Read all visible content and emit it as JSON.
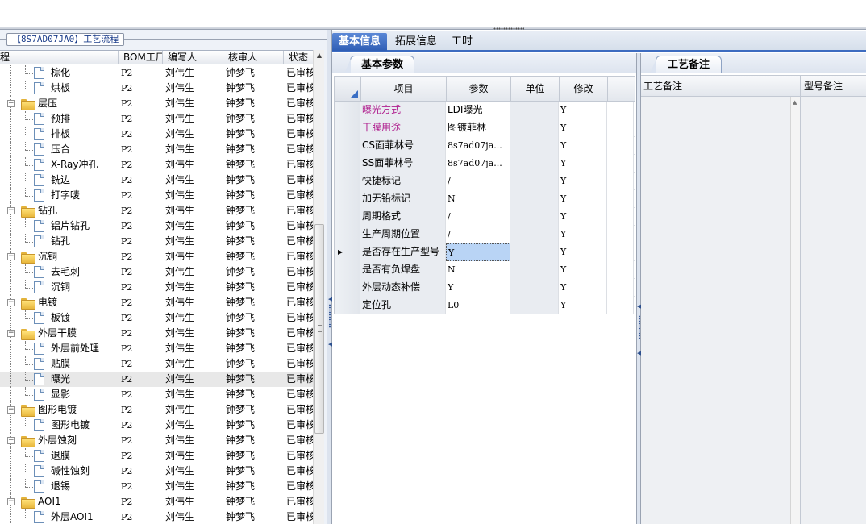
{
  "left_panel": {
    "title": "【8S7AD07JA0】工艺流程",
    "columns": [
      "程",
      "BOM工厂",
      "编写人",
      "核审人",
      "状态"
    ],
    "rows": [
      {
        "name": "棕化",
        "type": "doc",
        "bom": "P2",
        "author": "刘伟生",
        "reviewer": "钟梦飞",
        "status": "已审核"
      },
      {
        "name": "烘板",
        "type": "doc",
        "bom": "P2",
        "author": "刘伟生",
        "reviewer": "钟梦飞",
        "status": "已审核"
      },
      {
        "name": "层压",
        "type": "folder",
        "bom": "P2",
        "author": "刘伟生",
        "reviewer": "钟梦飞",
        "status": "已审核"
      },
      {
        "name": "预排",
        "type": "doc",
        "bom": "P2",
        "author": "刘伟生",
        "reviewer": "钟梦飞",
        "status": "已审核"
      },
      {
        "name": "排板",
        "type": "doc",
        "bom": "P2",
        "author": "刘伟生",
        "reviewer": "钟梦飞",
        "status": "已审核"
      },
      {
        "name": "压合",
        "type": "doc",
        "bom": "P2",
        "author": "刘伟生",
        "reviewer": "钟梦飞",
        "status": "已审核"
      },
      {
        "name": "X-Ray冲孔",
        "type": "doc",
        "bom": "P2",
        "author": "刘伟生",
        "reviewer": "钟梦飞",
        "status": "已审核"
      },
      {
        "name": "铣边",
        "type": "doc",
        "bom": "P2",
        "author": "刘伟生",
        "reviewer": "钟梦飞",
        "status": "已审核"
      },
      {
        "name": "打字唛",
        "type": "doc",
        "bom": "P2",
        "author": "刘伟生",
        "reviewer": "钟梦飞",
        "status": "已审核"
      },
      {
        "name": "钻孔",
        "type": "folder",
        "bom": "P2",
        "author": "刘伟生",
        "reviewer": "钟梦飞",
        "status": "已审核"
      },
      {
        "name": "铝片钻孔",
        "type": "doc",
        "bom": "P2",
        "author": "刘伟生",
        "reviewer": "钟梦飞",
        "status": "已审核"
      },
      {
        "name": "钻孔",
        "type": "doc",
        "bom": "P2",
        "author": "刘伟生",
        "reviewer": "钟梦飞",
        "status": "已审核"
      },
      {
        "name": "沉铜",
        "type": "folder",
        "bom": "P2",
        "author": "刘伟生",
        "reviewer": "钟梦飞",
        "status": "已审核"
      },
      {
        "name": "去毛刺",
        "type": "doc",
        "bom": "P2",
        "author": "刘伟生",
        "reviewer": "钟梦飞",
        "status": "已审核"
      },
      {
        "name": "沉铜",
        "type": "doc",
        "bom": "P2",
        "author": "刘伟生",
        "reviewer": "钟梦飞",
        "status": "已审核"
      },
      {
        "name": "电镀",
        "type": "folder",
        "bom": "P2",
        "author": "刘伟生",
        "reviewer": "钟梦飞",
        "status": "已审核"
      },
      {
        "name": "板镀",
        "type": "doc",
        "bom": "P2",
        "author": "刘伟生",
        "reviewer": "钟梦飞",
        "status": "已审核"
      },
      {
        "name": "外层干膜",
        "type": "folder",
        "bom": "P2",
        "author": "刘伟生",
        "reviewer": "钟梦飞",
        "status": "已审核"
      },
      {
        "name": "外层前处理",
        "type": "doc",
        "bom": "P2",
        "author": "刘伟生",
        "reviewer": "钟梦飞",
        "status": "已审核"
      },
      {
        "name": "贴膜",
        "type": "doc",
        "bom": "P2",
        "author": "刘伟生",
        "reviewer": "钟梦飞",
        "status": "已审核"
      },
      {
        "name": "曝光",
        "type": "doc",
        "bom": "P2",
        "author": "刘伟生",
        "reviewer": "钟梦飞",
        "status": "已审核",
        "selected": true
      },
      {
        "name": "显影",
        "type": "doc",
        "bom": "P2",
        "author": "刘伟生",
        "reviewer": "钟梦飞",
        "status": "已审核"
      },
      {
        "name": "图形电镀",
        "type": "folder",
        "bom": "P2",
        "author": "刘伟生",
        "reviewer": "钟梦飞",
        "status": "已审核"
      },
      {
        "name": "图形电镀",
        "type": "doc",
        "bom": "P2",
        "author": "刘伟生",
        "reviewer": "钟梦飞",
        "status": "已审核"
      },
      {
        "name": "外层蚀刻",
        "type": "folder",
        "bom": "P2",
        "author": "刘伟生",
        "reviewer": "钟梦飞",
        "status": "已审核"
      },
      {
        "name": "退膜",
        "type": "doc",
        "bom": "P2",
        "author": "刘伟生",
        "reviewer": "钟梦飞",
        "status": "已审核"
      },
      {
        "name": "碱性蚀刻",
        "type": "doc",
        "bom": "P2",
        "author": "刘伟生",
        "reviewer": "钟梦飞",
        "status": "已审核"
      },
      {
        "name": "退锡",
        "type": "doc",
        "bom": "P2",
        "author": "刘伟生",
        "reviewer": "钟梦飞",
        "status": "已审核"
      },
      {
        "name": "AOI1",
        "type": "folder",
        "bom": "P2",
        "author": "刘伟生",
        "reviewer": "钟梦飞",
        "status": "已审核"
      },
      {
        "name": "外层AOI1",
        "type": "doc",
        "bom": "P2",
        "author": "刘伟生",
        "reviewer": "钟梦飞",
        "status": "已审核"
      }
    ]
  },
  "main_tabs": [
    "基本信息",
    "拓展信息",
    "工时"
  ],
  "basic_panel": {
    "tab": "基本参数",
    "columns": [
      "项目",
      "参数",
      "单位",
      "修改"
    ],
    "rows": [
      {
        "item": "曝光方式",
        "value": "LDI曝光",
        "unit": "",
        "mod": "Y",
        "highlight": true
      },
      {
        "item": "干膜用途",
        "value": "图镀菲林",
        "unit": "",
        "mod": "Y",
        "highlight": true
      },
      {
        "item": "CS面菲林号",
        "value": "8s7ad07ja...",
        "unit": "",
        "mod": "Y"
      },
      {
        "item": "SS面菲林号",
        "value": "8s7ad07ja...",
        "unit": "",
        "mod": "Y"
      },
      {
        "item": "快捷标记",
        "value": "/",
        "unit": "",
        "mod": "Y"
      },
      {
        "item": "加无铅标记",
        "value": "N",
        "unit": "",
        "mod": "Y"
      },
      {
        "item": "周期格式",
        "value": "/",
        "unit": "",
        "mod": "Y"
      },
      {
        "item": "生产周期位置",
        "value": "/",
        "unit": "",
        "mod": "Y"
      },
      {
        "item": "是否存在生产型号",
        "value": "Y",
        "unit": "",
        "mod": "Y",
        "current": true
      },
      {
        "item": "是否有负焊盘",
        "value": "N",
        "unit": "",
        "mod": "Y"
      },
      {
        "item": "外层动态补偿",
        "value": "Y",
        "unit": "",
        "mod": "Y"
      },
      {
        "item": "定位孔",
        "value": "L0",
        "unit": "",
        "mod": "Y"
      }
    ]
  },
  "notes_panel": {
    "tab": "工艺备注",
    "columns": [
      "工艺备注",
      "型号备注"
    ]
  },
  "colors": {
    "accent": "#2f5eb5",
    "highlight_text": "#b0208f",
    "selection": "#b9d4f5"
  }
}
